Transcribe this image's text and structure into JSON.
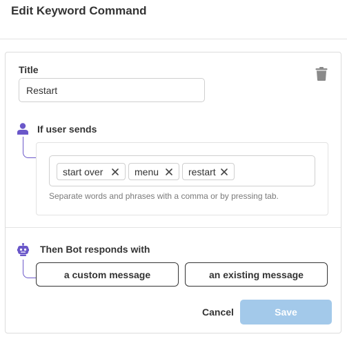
{
  "header": {
    "title": "Edit Keyword Command"
  },
  "form": {
    "title_label": "Title",
    "title_value": "Restart",
    "trigger": {
      "label": "If user sends",
      "keywords": [
        "start over",
        "menu",
        "restart"
      ],
      "helper": "Separate words and phrases with a comma or by pressing tab."
    },
    "response": {
      "label": "Then Bot responds with",
      "options": [
        "a custom message",
        "an existing message"
      ]
    },
    "actions": {
      "cancel": "Cancel",
      "save": "Save"
    }
  },
  "icons": {
    "delete": "trash-icon",
    "user": "user-icon",
    "bot": "bot-icon",
    "remove_tag": "close-icon"
  },
  "colors": {
    "accent": "#6a57c9",
    "save_disabled": "#a3c9ea",
    "trash": "#8a8a8a"
  }
}
